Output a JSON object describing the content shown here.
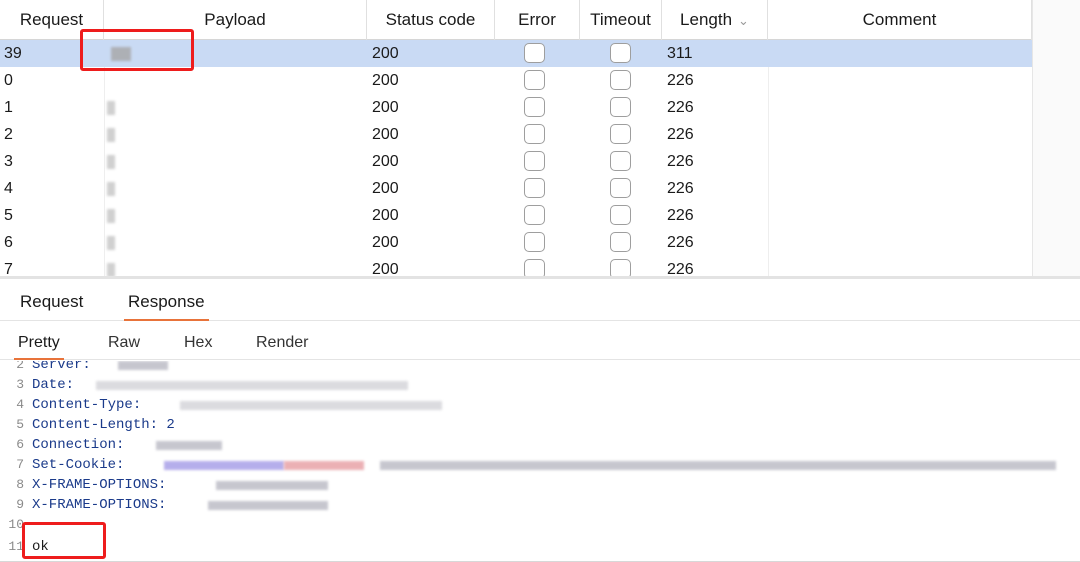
{
  "columns": [
    {
      "key": "request",
      "label": "Request"
    },
    {
      "key": "payload",
      "label": "Payload"
    },
    {
      "key": "status_code",
      "label": "Status code"
    },
    {
      "key": "error",
      "label": "Error"
    },
    {
      "key": "timeout",
      "label": "Timeout"
    },
    {
      "key": "length",
      "label": "Length"
    },
    {
      "key": "comment",
      "label": "Comment"
    }
  ],
  "sort_indicator": "⌄",
  "rows": [
    {
      "request": "39",
      "payload": "",
      "status": "200",
      "error": false,
      "timeout": false,
      "length": "311",
      "selected": true
    },
    {
      "request": "0",
      "payload": "",
      "status": "200",
      "error": false,
      "timeout": false,
      "length": "226",
      "selected": false
    },
    {
      "request": "1",
      "payload": "",
      "status": "200",
      "error": false,
      "timeout": false,
      "length": "226",
      "selected": false
    },
    {
      "request": "2",
      "payload": "",
      "status": "200",
      "error": false,
      "timeout": false,
      "length": "226",
      "selected": false
    },
    {
      "request": "3",
      "payload": "",
      "status": "200",
      "error": false,
      "timeout": false,
      "length": "226",
      "selected": false
    },
    {
      "request": "4",
      "payload": "",
      "status": "200",
      "error": false,
      "timeout": false,
      "length": "226",
      "selected": false
    },
    {
      "request": "5",
      "payload": "",
      "status": "200",
      "error": false,
      "timeout": false,
      "length": "226",
      "selected": false
    },
    {
      "request": "6",
      "payload": "",
      "status": "200",
      "error": false,
      "timeout": false,
      "length": "226",
      "selected": false
    },
    {
      "request": "7",
      "payload": "",
      "status": "200",
      "error": false,
      "timeout": false,
      "length": "226",
      "selected": false
    }
  ],
  "panel_tabs": [
    "Request",
    "Response"
  ],
  "active_panel_tab": "Response",
  "view_tabs": [
    "Pretty",
    "Raw",
    "Hex",
    "Render"
  ],
  "active_view_tab": "Pretty",
  "response_lines": [
    {
      "n": "2",
      "text": "Server:"
    },
    {
      "n": "3",
      "text": "Date:"
    },
    {
      "n": "4",
      "text": "Content-Type:"
    },
    {
      "n": "5",
      "text": "Content-Length: 2"
    },
    {
      "n": "6",
      "text": "Connection:"
    },
    {
      "n": "7",
      "text": "Set-Cookie:"
    },
    {
      "n": "8",
      "text": "X-FRAME-OPTIONS:"
    },
    {
      "n": "9",
      "text": "X-FRAME-OPTIONS:"
    },
    {
      "n": "10",
      "text": ""
    },
    {
      "n": "11",
      "text": "ok"
    }
  ],
  "colors": {
    "selected_row": "#c9daf4",
    "accent_tab": "#e8733a",
    "highlight_box": "#ee1c1c",
    "header_key": "#1a3a8a"
  },
  "icons": [
    "chevron-down-icon",
    "checkbox-icon"
  ]
}
